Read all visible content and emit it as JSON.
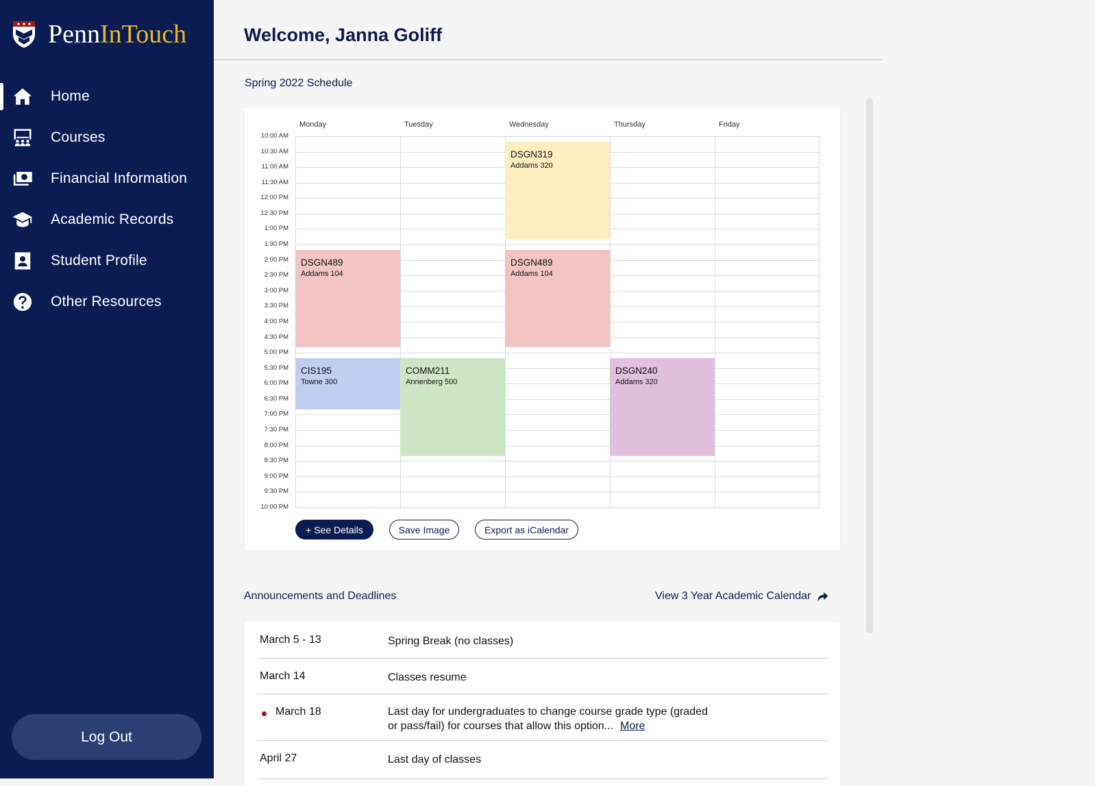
{
  "app": {
    "logo_part1": "Penn",
    "logo_part2": "InTouch"
  },
  "sidebar": {
    "items": [
      {
        "label": "Home",
        "icon": "home-icon",
        "active": true
      },
      {
        "label": "Courses",
        "icon": "classroom-icon"
      },
      {
        "label": "Financial Information",
        "icon": "money-icon"
      },
      {
        "label": "Academic Records",
        "icon": "graduation-cap-icon"
      },
      {
        "label": "Student Profile",
        "icon": "id-card-icon"
      },
      {
        "label": "Other Resources",
        "icon": "help-circle-icon"
      }
    ],
    "logout_label": "Log Out"
  },
  "header": {
    "welcome": "Welcome, Janna Goliff"
  },
  "schedule": {
    "title": "Spring 2022 Schedule",
    "days": [
      "Monday",
      "Tuesday",
      "Wednesday",
      "Thursday",
      "Friday"
    ],
    "times": [
      "10:00 AM",
      "10:30 AM",
      "11:00 AM",
      "11:30 AM",
      "12:00 PM",
      "12:30 PM",
      "1:00 PM",
      "1:30 PM",
      "2:00 PM",
      "2:30 PM",
      "3:00 PM",
      "3:30 PM",
      "4:00 PM",
      "4:30 PM",
      "5:00 PM",
      "5:30 PM",
      "6:00 PM",
      "6:30 PM",
      "7:00 PM",
      "7:30 PM",
      "8:00 PM",
      "8:30 PM",
      "9:00 PM",
      "9:30 PM",
      "10:00 PM"
    ],
    "events": [
      {
        "code": "DSGN319",
        "room": "Addams 320",
        "day": 2,
        "start": 10.17,
        "end": 13.33,
        "color": "#fdefc0"
      },
      {
        "code": "DSGN489",
        "room": "Addams 104",
        "day": 0,
        "start": 13.67,
        "end": 16.83,
        "color": "#f2c4c4"
      },
      {
        "code": "DSGN489",
        "room": "Addams 104",
        "day": 2,
        "start": 13.67,
        "end": 16.83,
        "color": "#f2c4c4"
      },
      {
        "code": "CIS195",
        "room": "Towne 300",
        "day": 0,
        "start": 17.17,
        "end": 18.83,
        "color": "#c0cef0"
      },
      {
        "code": "COMM211",
        "room": "Annenberg 500",
        "day": 1,
        "start": 17.17,
        "end": 20.33,
        "color": "#cfe6c6"
      },
      {
        "code": "DSGN240",
        "room": "Addams 320",
        "day": 3,
        "start": 17.17,
        "end": 20.33,
        "color": "#e0c0dc"
      }
    ],
    "buttons": {
      "details": "+ See Details",
      "save": "Save Image",
      "export": "Export as iCalendar"
    }
  },
  "announcements": {
    "title": "Announcements and Deadlines",
    "calendar_link": "View 3 Year Academic Calendar",
    "items": [
      {
        "date": "March 5 - 13",
        "text": "Spring Break (no classes)"
      },
      {
        "date": "March 14",
        "text": "Classes resume"
      },
      {
        "date": "March 18",
        "text_line1": "Last day for undergraduates to change course grade type (graded",
        "text_line2": "or pass/fail) for courses that allow this option...",
        "more": "More",
        "flagged": true
      },
      {
        "date": "April 27",
        "text": "Last day of classes"
      }
    ]
  },
  "colors": {
    "navy": "#0b1c52",
    "gold": "#e8b82a",
    "logout_bg": "#2c3f73",
    "flag_dot": "#9e1b1b"
  }
}
